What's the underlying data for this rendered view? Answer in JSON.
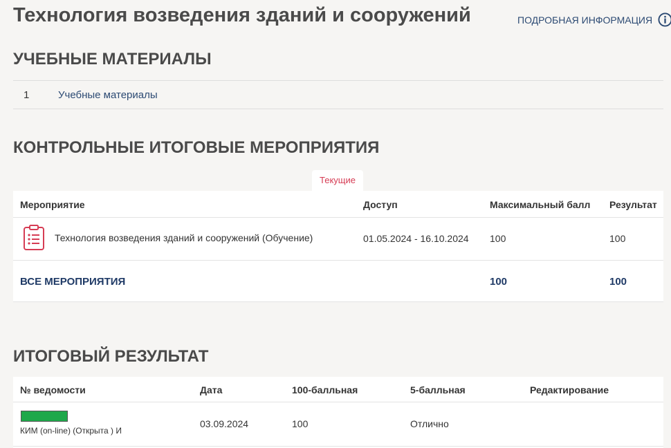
{
  "page": {
    "title": "Технология возведения зданий и сооружений",
    "info_link": "ПОДРОБНАЯ ИНФОРМАЦИЯ"
  },
  "materials": {
    "title": "УЧЕБНЫЕ МАТЕРИАЛЫ",
    "items": [
      {
        "num": "1",
        "label": "Учебные материалы"
      }
    ]
  },
  "control": {
    "title": "КОНТРОЛЬНЫЕ ИТОГОВЫЕ МЕРОПРИЯТИЯ",
    "tab_current": "Текущие",
    "headers": {
      "event": "Мероприятие",
      "access": "Доступ",
      "max_score": "Максимальный балл",
      "result": "Результат"
    },
    "rows": [
      {
        "event": "Технология возведения зданий и сооружений (Обучение)",
        "access": "01.05.2024 - 16.10.2024",
        "max_score": "100",
        "result": "100"
      }
    ],
    "total": {
      "label": "ВСЕ МЕРОПРИЯТИЯ",
      "max_score": "100",
      "result": "100"
    },
    "icon": "clipboard-list-icon",
    "icon_color": "#d63c54"
  },
  "final": {
    "title": "ИТОГОВЫЙ РЕЗУЛЬТАТ",
    "headers": {
      "record_no": "№ ведомости",
      "date": "Дата",
      "score100": "100-балльная",
      "score5": "5-балльная",
      "edit": "Редактирование"
    },
    "rows": [
      {
        "record_text": "КИМ (on-line) (Открыта ) И",
        "date": "03.09.2024",
        "score100": "100",
        "score5": "Отлично"
      }
    ],
    "redaction_color": "#1ea84a"
  },
  "colors": {
    "accent": "#d63c54",
    "link": "#2c4a73"
  }
}
